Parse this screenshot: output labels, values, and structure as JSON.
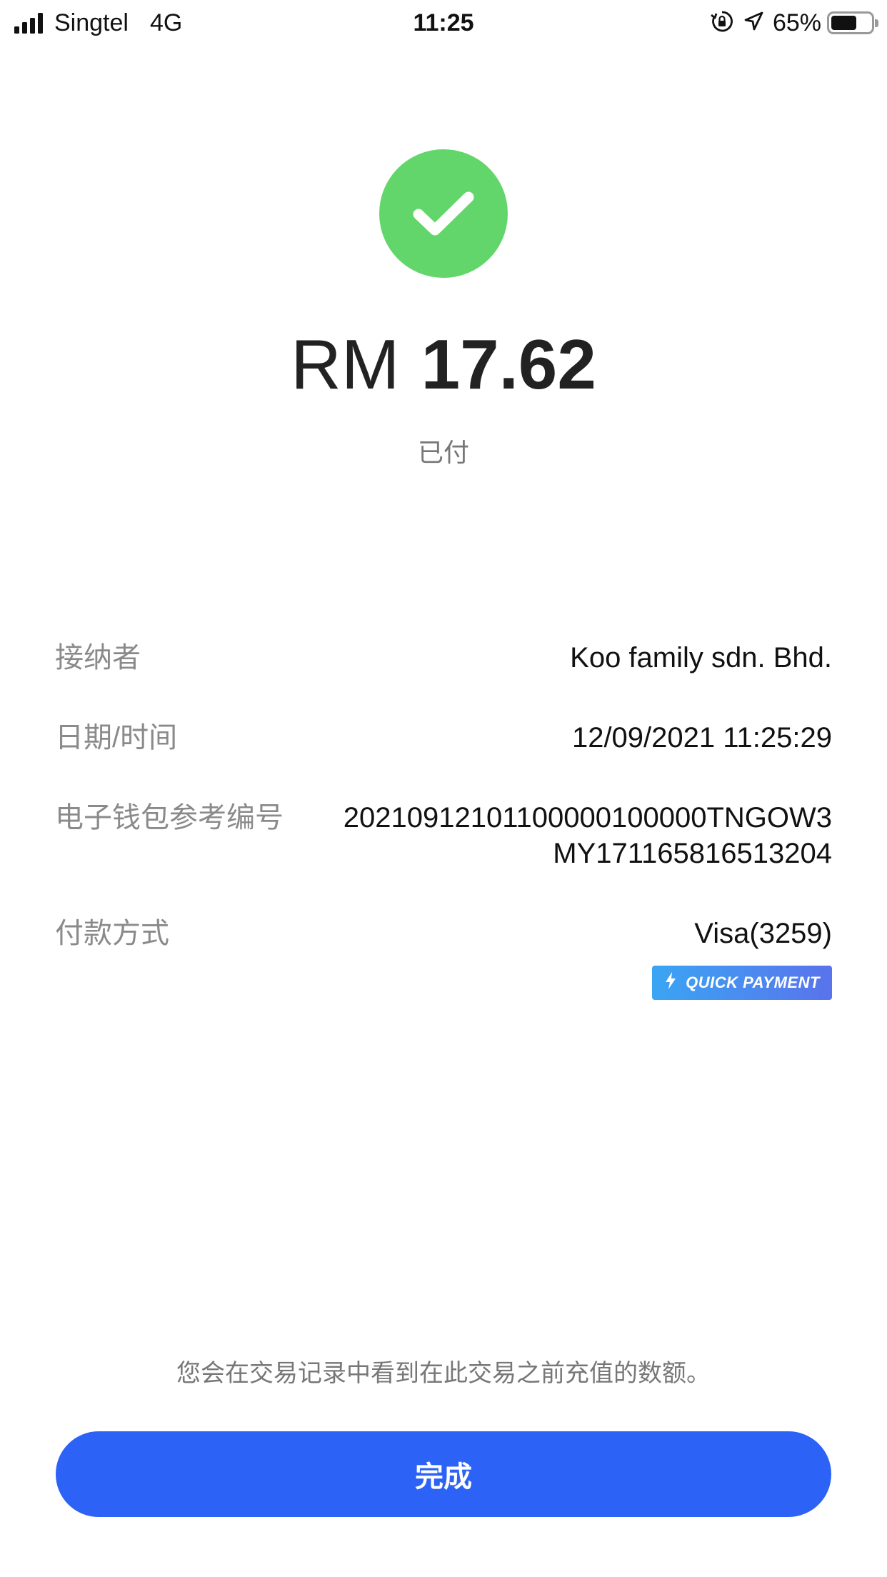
{
  "status_bar": {
    "carrier": "Singtel",
    "network": "4G",
    "time": "11:25",
    "battery": "65%",
    "battery_level": 0.65,
    "icons": [
      "signal-icon",
      "orientation-lock-icon",
      "location-arrow-icon",
      "battery-icon"
    ]
  },
  "hero": {
    "icon": "checkmark-icon",
    "icon_color": "#63d66b",
    "currency": "RM",
    "amount": "17.62",
    "status": "已付"
  },
  "details": {
    "recipient": {
      "label": "接纳者",
      "value": "Koo family sdn. Bhd."
    },
    "datetime": {
      "label": "日期/时间",
      "value": "12/09/2021 11:25:29"
    },
    "reference": {
      "label": "电子钱包参考编号",
      "value": "20210912101100000100000TNGOW3MY171165816513204"
    },
    "payment_method": {
      "label": "付款方式",
      "value": "Visa(3259)",
      "badge": "QUICK PAYMENT",
      "badge_icon": "lightning-bolt-icon"
    }
  },
  "footer": {
    "note": "您会在交易记录中看到在此交易之前充值的数额。",
    "done_label": "完成",
    "button_color": "#2c62f6"
  }
}
